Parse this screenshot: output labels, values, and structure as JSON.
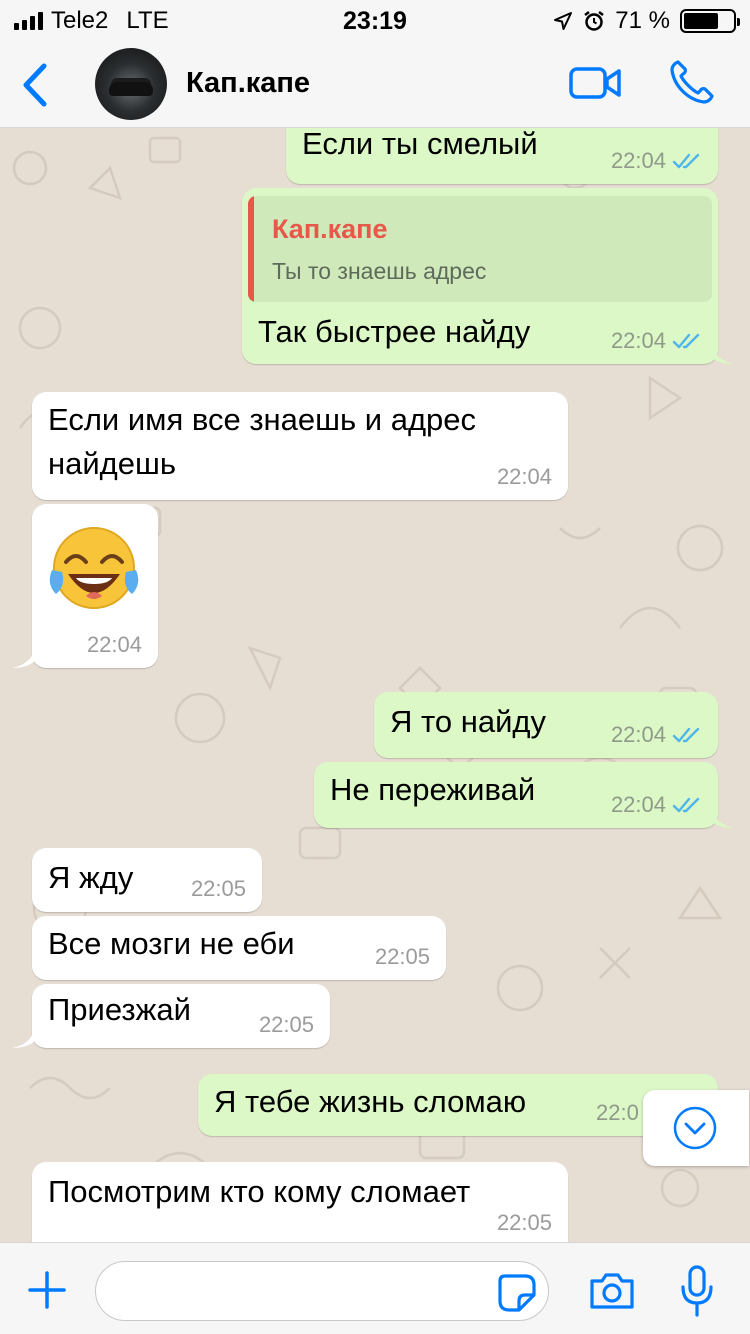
{
  "status": {
    "carrier": "Tele2",
    "network": "LTE",
    "time": "23:19",
    "battery_percent": "71 %",
    "battery_level": 0.71
  },
  "header": {
    "contact_name": "Кап.капе",
    "avatar_icon": "car-photo-avatar",
    "back_icon": "chevron-left-icon",
    "video_icon": "video-call-icon",
    "call_icon": "phone-icon"
  },
  "messages": [
    {
      "dir": "out",
      "text": "Если ты смелый",
      "time": "22:04",
      "status": "read"
    },
    {
      "dir": "out",
      "quote": {
        "author": "Кап.капе",
        "text": "Ты то знаешь адрес"
      },
      "text": "Так быстрее найду",
      "time": "22:04",
      "status": "read"
    },
    {
      "dir": "in",
      "text_lines": [
        "Если имя все знаешь и адрес",
        "найдешь"
      ],
      "time": "22:04"
    },
    {
      "dir": "in",
      "emoji": "face-with-tears-of-joy",
      "time": "22:04"
    },
    {
      "dir": "out",
      "text": "Я то найду",
      "time": "22:04",
      "status": "read"
    },
    {
      "dir": "out",
      "text": "Не переживай",
      "time": "22:04",
      "status": "read"
    },
    {
      "dir": "in",
      "text": "Я жду",
      "time": "22:05"
    },
    {
      "dir": "in",
      "text": "Все мозги не еби",
      "time": "22:05"
    },
    {
      "dir": "in",
      "text": "Приезжай",
      "time": "22:05"
    },
    {
      "dir": "out",
      "text": "Я тебе жизнь сломаю",
      "time": "22:0"
    },
    {
      "dir": "in",
      "text": "Посмотрим кто кому сломает",
      "time": "22:05"
    }
  ],
  "input": {
    "value": "",
    "placeholder": ""
  },
  "colors": {
    "accent": "#007aff",
    "outgoing_bubble": "#dcf8c6",
    "incoming_bubble": "#ffffff",
    "read_ticks": "#4fb6ec",
    "quote_author": "#e8584a"
  }
}
